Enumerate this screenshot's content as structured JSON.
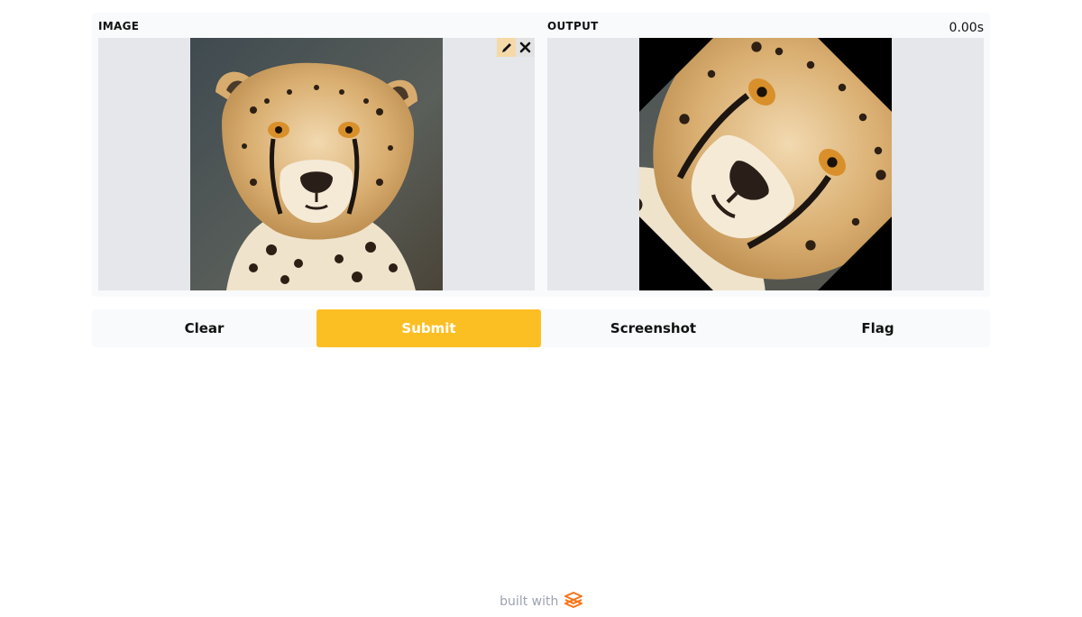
{
  "input_panel": {
    "label": "IMAGE",
    "image": "cheetah-portrait",
    "tools": {
      "edit_icon": "pencil-icon",
      "clear_icon": "close-icon"
    }
  },
  "output_panel": {
    "label": "OUTPUT",
    "timer": "0.00s",
    "image": "cheetah-portrait-rotated-45deg"
  },
  "buttons": {
    "clear": "Clear",
    "submit": "Submit",
    "screenshot": "Screenshot",
    "flag": "Flag"
  },
  "footer": {
    "text": "built with",
    "logo_icon": "gradio-logo-icon"
  },
  "colors": {
    "accent": "#fbbf24",
    "panel_bg": "#f9fafb",
    "image_bg": "#e5e7eb",
    "logo": "#f97316"
  }
}
